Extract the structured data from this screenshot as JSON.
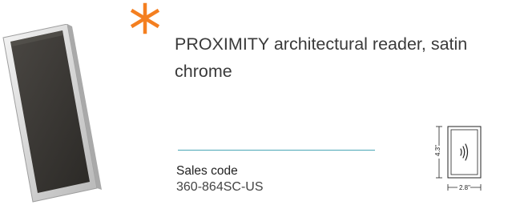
{
  "product": {
    "title": "PROXIMITY architectural reader, satin chrome",
    "sales_code_label": "Sales code",
    "sales_code_value": "360-864SC-US"
  },
  "dimensions": {
    "height_label": "4.3\"",
    "width_label": "2.8\""
  },
  "icons": {
    "accent": "asterisk-icon",
    "reader_symbol": "contactless-icon"
  },
  "colors": {
    "accent": "#f47f20",
    "divider": "#4aa7b5"
  }
}
